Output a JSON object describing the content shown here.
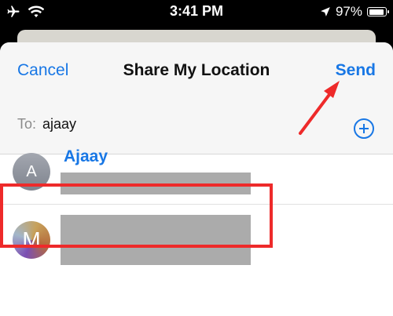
{
  "status_bar": {
    "time": "3:41 PM",
    "battery": "97%",
    "battery_level": 0.97
  },
  "sheet": {
    "cancel_label": "Cancel",
    "title": "Share My Location",
    "send_label": "Send",
    "to_label": "To:",
    "to_value": "ajaay"
  },
  "contacts": [
    {
      "avatar_initial": "A",
      "name": "Ajaay"
    },
    {
      "avatar_initial": "M",
      "name": ""
    }
  ],
  "annotations": {
    "highlight_color": "#ee2a2a",
    "arrow_color": "#ee2a2a"
  },
  "accent_color": "#1877e5"
}
